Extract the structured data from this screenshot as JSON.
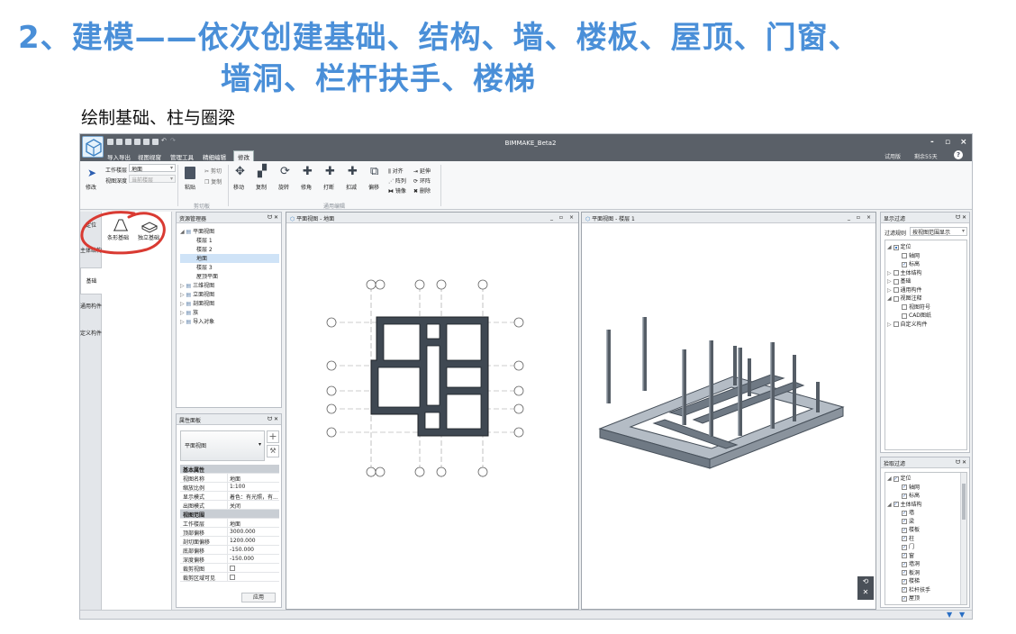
{
  "slide": {
    "title_line1": "2、建模——依次创建基础、结构、墙、楼板、屋顶、门窗、",
    "title_line2": "墙洞、栏杆扶手、楼梯",
    "subtitle": "绘制基础、柱与圈梁",
    "title_color": "#4A8FD8"
  },
  "app": {
    "title": "BIMMAKE_Beta2",
    "menu": [
      "导入导出",
      "视图视窗",
      "管理工具",
      "精细编辑",
      "修改"
    ],
    "active_menu": "修改",
    "trial_label": "试用版",
    "days_left": "剩余55天",
    "help": "?",
    "window_buttons": [
      "-",
      "▫",
      "×"
    ]
  },
  "ribbon": {
    "modify": "修改",
    "work_level_label": "工作楼层",
    "work_level_value": "地面",
    "view_depth_label": "视图深度",
    "view_depth_value": "当前楼层",
    "paste": "粘贴",
    "cut": "剪切",
    "copy": "复制",
    "clipboard_group": "剪切板",
    "tools": [
      "移动",
      "复制",
      "旋转",
      "修角",
      "打断",
      "扣减",
      "偏移"
    ],
    "align": "对齐",
    "extend": "延伸",
    "array": "阵列",
    "ring": "环阵",
    "mirror": "镜像",
    "delete": "删除",
    "common_group": "通用编辑"
  },
  "vertical_tabs": [
    "定位",
    "主体结构",
    "基础",
    "通用构件",
    "定义构件"
  ],
  "foundation_tools": [
    "条形基础",
    "独立基础"
  ],
  "resource_manager": {
    "title": "资源管理器",
    "tree": [
      {
        "label": "平面视图",
        "level": 0,
        "expand": "◢"
      },
      {
        "label": "楼层 1",
        "level": 1
      },
      {
        "label": "楼层 2",
        "level": 1
      },
      {
        "label": "地面",
        "level": 1,
        "selected": true
      },
      {
        "label": "楼层 3",
        "level": 1
      },
      {
        "label": "屋顶平面",
        "level": 1
      },
      {
        "label": "三维视图",
        "level": 0,
        "expand": "▷"
      },
      {
        "label": "立面视图",
        "level": 0,
        "expand": "▷"
      },
      {
        "label": "剖面视图",
        "level": 0,
        "expand": "▷"
      },
      {
        "label": "族",
        "level": 0,
        "expand": "▷"
      },
      {
        "label": "导入对象",
        "level": 0,
        "expand": "▷"
      }
    ]
  },
  "properties": {
    "title": "属性面板",
    "type_value": "平面视图",
    "rows": [
      {
        "header": "基本属性"
      },
      {
        "k": "视图名称",
        "v": "地面"
      },
      {
        "k": "缩放比例",
        "v": "1:100"
      },
      {
        "k": "显示模式",
        "v": "着色：有光照，有..."
      },
      {
        "k": "出图模式",
        "v": "关闭"
      },
      {
        "header": "视图范围"
      },
      {
        "k": "工作楼层",
        "v": "地面"
      },
      {
        "k": "顶部偏移",
        "v": "3000.000"
      },
      {
        "k": "剖切面偏移",
        "v": "1200.000"
      },
      {
        "k": "底部偏移",
        "v": "-150.000"
      },
      {
        "k": "深度偏移",
        "v": "-150.000"
      },
      {
        "k": "裁剪视图",
        "v": "",
        "check": true
      },
      {
        "k": "裁剪区域可见",
        "v": "",
        "check": true
      }
    ],
    "apply": "应用"
  },
  "view_plan": {
    "title": "平面视图 - 地面",
    "controls": [
      "_",
      "▫",
      "×"
    ]
  },
  "view_3d": {
    "title": "平面视图 - 楼层 1",
    "controls": [
      "_",
      "▫",
      "×"
    ]
  },
  "display_filter": {
    "title": "显示过滤",
    "rule_label": "过滤规则",
    "rule_value": "按视图范围显示",
    "tree": [
      {
        "label": "定位",
        "level": 0,
        "expand": "◢",
        "state": "partial"
      },
      {
        "label": "轴网",
        "level": 1,
        "state": "off"
      },
      {
        "label": "标高",
        "level": 1,
        "state": "on"
      },
      {
        "label": "主体结构",
        "level": 0,
        "expand": "▷",
        "state": "off"
      },
      {
        "label": "基础",
        "level": 0,
        "expand": "▷",
        "state": "off"
      },
      {
        "label": "通用构件",
        "level": 0,
        "expand": "▷",
        "state": "off"
      },
      {
        "label": "视图注释",
        "level": 0,
        "expand": "◢",
        "state": "off"
      },
      {
        "label": "视图符号",
        "level": 1,
        "state": "off"
      },
      {
        "label": "CAD图纸",
        "level": 1,
        "state": "off"
      },
      {
        "label": "自定义构件",
        "level": 0,
        "expand": "▷",
        "state": "off"
      }
    ]
  },
  "pick_filter": {
    "title": "拾取过滤",
    "tree": [
      {
        "label": "定位",
        "level": 0,
        "expand": "◢",
        "state": "on"
      },
      {
        "label": "轴网",
        "level": 1,
        "state": "on"
      },
      {
        "label": "标高",
        "level": 1,
        "state": "on"
      },
      {
        "label": "主体结构",
        "level": 0,
        "expand": "◢",
        "state": "on"
      },
      {
        "label": "墙",
        "level": 1,
        "state": "on"
      },
      {
        "label": "梁",
        "level": 1,
        "state": "on"
      },
      {
        "label": "楼板",
        "level": 1,
        "state": "on"
      },
      {
        "label": "柱",
        "level": 1,
        "state": "on"
      },
      {
        "label": "门",
        "level": 1,
        "state": "on"
      },
      {
        "label": "窗",
        "level": 1,
        "state": "on"
      },
      {
        "label": "墙洞",
        "level": 1,
        "state": "on"
      },
      {
        "label": "板洞",
        "level": 1,
        "state": "on"
      },
      {
        "label": "楼梯",
        "level": 1,
        "state": "on"
      },
      {
        "label": "栏杆扶手",
        "level": 1,
        "state": "on"
      },
      {
        "label": "屋顶",
        "level": 1,
        "state": "on"
      }
    ]
  }
}
